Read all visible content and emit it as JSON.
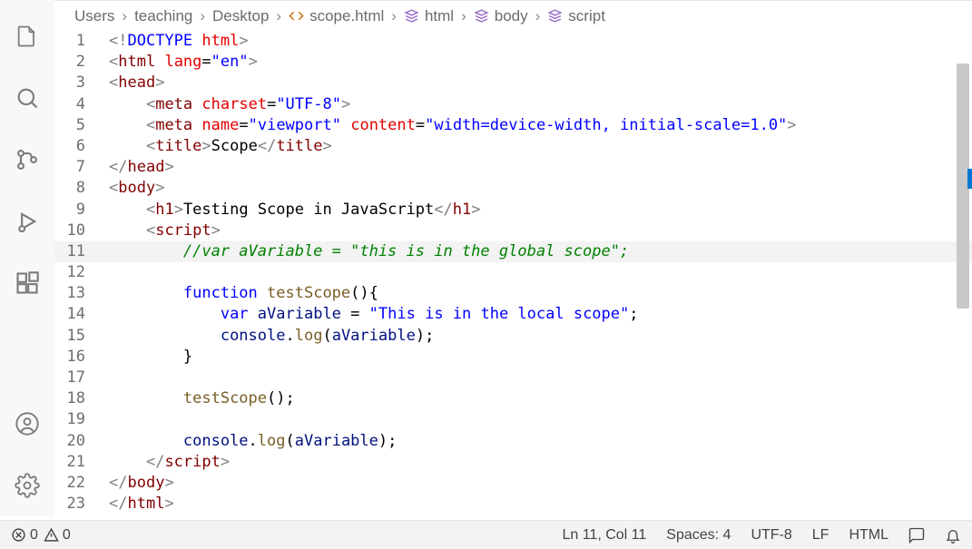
{
  "breadcrumbs": {
    "items": [
      "Users",
      "teaching",
      "Desktop",
      "scope.html",
      "html",
      "body",
      "script"
    ]
  },
  "code": {
    "lines": [
      {
        "n": 1,
        "indent": 0,
        "tokens": [
          [
            "t-gray",
            "<!"
          ],
          [
            "t-doctype",
            "DOCTYPE"
          ],
          [
            "t-text",
            " "
          ],
          [
            "t-attr",
            "html"
          ],
          [
            "t-gray",
            ">"
          ]
        ]
      },
      {
        "n": 2,
        "indent": 0,
        "tokens": [
          [
            "t-gray",
            "<"
          ],
          [
            "t-tag",
            "html"
          ],
          [
            "t-text",
            " "
          ],
          [
            "t-attr",
            "lang"
          ],
          [
            "t-op",
            "="
          ],
          [
            "t-string",
            "\"en\""
          ],
          [
            "t-gray",
            ">"
          ]
        ]
      },
      {
        "n": 3,
        "indent": 0,
        "tokens": [
          [
            "t-gray",
            "<"
          ],
          [
            "t-tag",
            "head"
          ],
          [
            "t-gray",
            ">"
          ]
        ]
      },
      {
        "n": 4,
        "indent": 1,
        "tokens": [
          [
            "t-gray",
            "<"
          ],
          [
            "t-tag",
            "meta"
          ],
          [
            "t-text",
            " "
          ],
          [
            "t-attr",
            "charset"
          ],
          [
            "t-op",
            "="
          ],
          [
            "t-string",
            "\"UTF-8\""
          ],
          [
            "t-gray",
            ">"
          ]
        ]
      },
      {
        "n": 5,
        "indent": 1,
        "tokens": [
          [
            "t-gray",
            "<"
          ],
          [
            "t-tag",
            "meta"
          ],
          [
            "t-text",
            " "
          ],
          [
            "t-attr",
            "name"
          ],
          [
            "t-op",
            "="
          ],
          [
            "t-string",
            "\"viewport\""
          ],
          [
            "t-text",
            " "
          ],
          [
            "t-attr",
            "content"
          ],
          [
            "t-op",
            "="
          ],
          [
            "t-string",
            "\"width=device-width, initial-scale=1.0\""
          ],
          [
            "t-gray",
            ">"
          ]
        ]
      },
      {
        "n": 6,
        "indent": 1,
        "tokens": [
          [
            "t-gray",
            "<"
          ],
          [
            "t-tag",
            "title"
          ],
          [
            "t-gray",
            ">"
          ],
          [
            "t-text",
            "Scope"
          ],
          [
            "t-gray",
            "</"
          ],
          [
            "t-tag",
            "title"
          ],
          [
            "t-gray",
            ">"
          ]
        ]
      },
      {
        "n": 7,
        "indent": 0,
        "tokens": [
          [
            "t-gray",
            "</"
          ],
          [
            "t-tag",
            "head"
          ],
          [
            "t-gray",
            ">"
          ]
        ]
      },
      {
        "n": 8,
        "indent": 0,
        "tokens": [
          [
            "t-gray",
            "<"
          ],
          [
            "t-tag",
            "body"
          ],
          [
            "t-gray",
            ">"
          ]
        ]
      },
      {
        "n": 9,
        "indent": 1,
        "tokens": [
          [
            "t-gray",
            "<"
          ],
          [
            "t-tag",
            "h1"
          ],
          [
            "t-gray",
            ">"
          ],
          [
            "t-text",
            "Testing Scope in JavaScript"
          ],
          [
            "t-gray",
            "</"
          ],
          [
            "t-tag",
            "h1"
          ],
          [
            "t-gray",
            ">"
          ]
        ]
      },
      {
        "n": 10,
        "indent": 1,
        "tokens": [
          [
            "t-gray",
            "<"
          ],
          [
            "t-tag",
            "script"
          ],
          [
            "t-gray",
            ">"
          ]
        ]
      },
      {
        "n": 11,
        "indent": 2,
        "highlight": true,
        "tokens": [
          [
            "t-comment",
            "//var aVariable = \"this is in the global scope\";"
          ]
        ]
      },
      {
        "n": 12,
        "indent": 2,
        "tokens": []
      },
      {
        "n": 13,
        "indent": 2,
        "tokens": [
          [
            "t-keyword",
            "function"
          ],
          [
            "t-text",
            " "
          ],
          [
            "t-funcname",
            "testScope"
          ],
          [
            "t-paren",
            "(){"
          ]
        ]
      },
      {
        "n": 14,
        "indent": 3,
        "tokens": [
          [
            "t-varkw",
            "var"
          ],
          [
            "t-text",
            " "
          ],
          [
            "t-ident",
            "aVariable"
          ],
          [
            "t-text",
            " "
          ],
          [
            "t-op",
            "="
          ],
          [
            "t-text",
            " "
          ],
          [
            "t-string",
            "\"This is in the local scope\""
          ],
          [
            "t-op",
            ";"
          ]
        ]
      },
      {
        "n": 15,
        "indent": 3,
        "tokens": [
          [
            "t-ident",
            "console"
          ],
          [
            "t-op",
            "."
          ],
          [
            "t-call",
            "log"
          ],
          [
            "t-paren",
            "("
          ],
          [
            "t-ident",
            "aVariable"
          ],
          [
            "t-paren",
            ")"
          ],
          [
            "t-op",
            ";"
          ]
        ]
      },
      {
        "n": 16,
        "indent": 2,
        "tokens": [
          [
            "t-paren",
            "}"
          ]
        ]
      },
      {
        "n": 17,
        "indent": 2,
        "tokens": []
      },
      {
        "n": 18,
        "indent": 2,
        "tokens": [
          [
            "t-call",
            "testScope"
          ],
          [
            "t-paren",
            "()"
          ],
          [
            "t-op",
            ";"
          ]
        ]
      },
      {
        "n": 19,
        "indent": 2,
        "tokens": []
      },
      {
        "n": 20,
        "indent": 2,
        "tokens": [
          [
            "t-ident",
            "console"
          ],
          [
            "t-op",
            "."
          ],
          [
            "t-call",
            "log"
          ],
          [
            "t-paren",
            "("
          ],
          [
            "t-ident",
            "aVariable"
          ],
          [
            "t-paren",
            ")"
          ],
          [
            "t-op",
            ";"
          ]
        ]
      },
      {
        "n": 21,
        "indent": 1,
        "tokens": [
          [
            "t-gray",
            "</"
          ],
          [
            "t-tag",
            "script"
          ],
          [
            "t-gray",
            ">"
          ]
        ]
      },
      {
        "n": 22,
        "indent": 0,
        "tokens": [
          [
            "t-gray",
            "</"
          ],
          [
            "t-tag",
            "body"
          ],
          [
            "t-gray",
            ">"
          ]
        ]
      },
      {
        "n": 23,
        "indent": 0,
        "tokens": [
          [
            "t-gray",
            "</"
          ],
          [
            "t-tag",
            "html"
          ],
          [
            "t-gray",
            ">"
          ]
        ]
      }
    ]
  },
  "statusbar": {
    "errors": "0",
    "warnings": "0",
    "position": "Ln 11, Col 11",
    "spaces": "Spaces: 4",
    "encoding": "UTF-8",
    "eol": "LF",
    "language": "HTML"
  }
}
